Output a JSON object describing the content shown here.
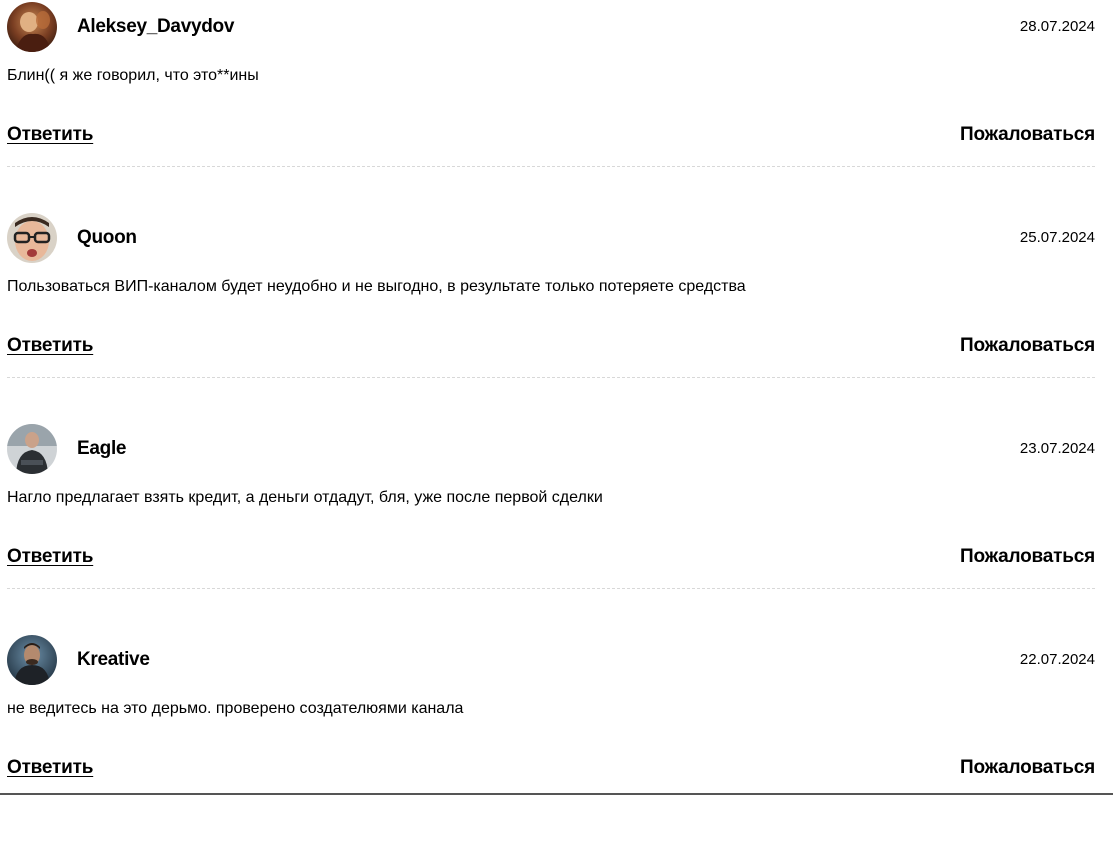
{
  "comments": [
    {
      "username": "Aleksey_Davydov",
      "date": "28.07.2024",
      "text": "Блин(( я же говорил, что это**ины",
      "reply_label": "Ответить",
      "report_label": "Пожаловаться",
      "avatar_icon": "user-avatar-icon"
    },
    {
      "username": "Quoon",
      "date": "25.07.2024",
      "text": "Пользоваться ВИП-каналом будет неудобно и не выгодно, в результате только потеряете средства",
      "reply_label": "Ответить",
      "report_label": "Пожаловаться",
      "avatar_icon": "user-avatar-icon"
    },
    {
      "username": "Eagle",
      "date": "23.07.2024",
      "text": "Нагло предлагает взять кредит, а деньги отдадут, бля, уже после первой сделки",
      "reply_label": "Ответить",
      "report_label": "Пожаловаться",
      "avatar_icon": "user-avatar-icon"
    },
    {
      "username": "Kreative",
      "date": "22.07.2024",
      "text": "не ведитесь на это дерьмо. проверено создателюями канала",
      "reply_label": "Ответить",
      "report_label": "Пожаловаться",
      "avatar_icon": "user-avatar-icon"
    }
  ],
  "colors": {
    "text": "#000000",
    "divider": "#d8d8d8",
    "background": "#ffffff"
  }
}
